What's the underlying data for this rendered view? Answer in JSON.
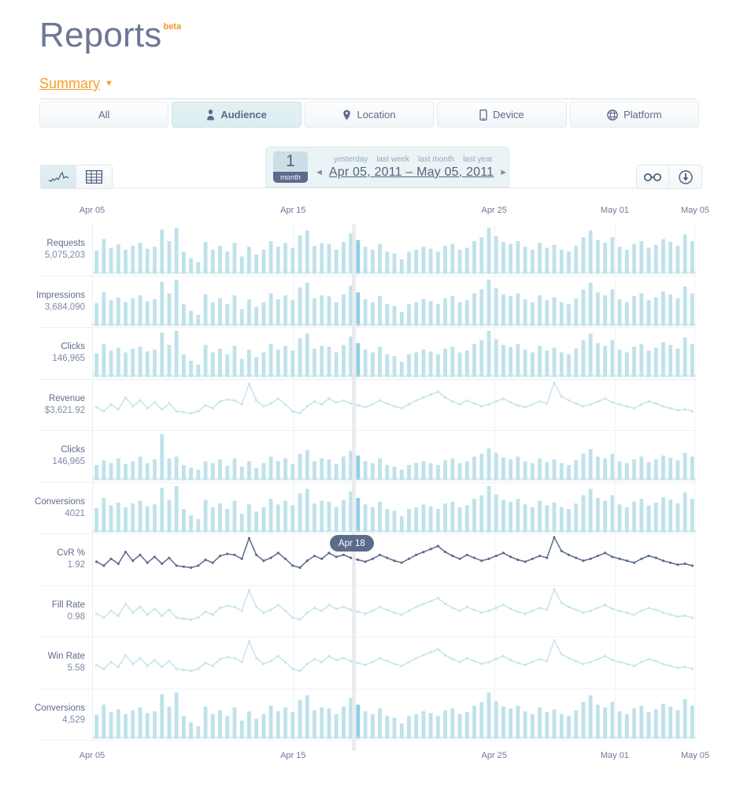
{
  "header": {
    "title": "Reports",
    "beta": "beta",
    "summary_label": "Summary",
    "summary_caret": "▼"
  },
  "tabs": [
    {
      "label": "All",
      "icon": "none",
      "active": false
    },
    {
      "label": "Audience",
      "icon": "person-icon",
      "active": true
    },
    {
      "label": "Location",
      "icon": "map-pin-icon",
      "active": false
    },
    {
      "label": "Device",
      "icon": "mobile-phone-icon",
      "active": false
    },
    {
      "label": "Platform",
      "icon": "globe-icon",
      "active": false
    }
  ],
  "toolbar": {
    "view_chart_icon": "line-chart-icon",
    "view_table_icon": "table-grid-icon",
    "link_icon": "chain-link-icon",
    "download_icon": "download-circle-icon",
    "daterange": {
      "badge_number": "1",
      "badge_unit": "month",
      "quick_links": [
        "yesterday",
        "last week",
        "last month",
        "last year"
      ],
      "prev_arrow": "◄",
      "next_arrow": "►",
      "range_text": "Apr 05, 2011  –  May 05, 2011"
    }
  },
  "tooltip": {
    "label": "Apr 18"
  },
  "colors": {
    "accent_orange": "#f5a02a",
    "text_blue": "#5d6a8a",
    "bar_light": "#bfe2ea",
    "line_light": "#c6e5ec",
    "line_dark": "#5c6b8c",
    "tab_active_bg": "#dceef1"
  },
  "chart_data": {
    "type": "line",
    "title": "Reports — Audience summary",
    "xlabel": "",
    "ylabel": "",
    "grid": true,
    "legend": "none",
    "x_axis_ticks": [
      {
        "label": "Apr 05",
        "pos": 0.0
      },
      {
        "label": "Apr 15",
        "pos": 0.3333
      },
      {
        "label": "Apr 25",
        "pos": 0.6667
      },
      {
        "label": "May 01",
        "pos": 0.8667
      },
      {
        "label": "May 05",
        "pos": 1.0
      }
    ],
    "x_range": [
      "Apr 05, 2011",
      "May 05, 2011"
    ],
    "highlight": {
      "label": "Apr 18",
      "pos": 0.4333
    },
    "series": [
      {
        "name": "Requests",
        "total": "5,075,203",
        "type": "bar",
        "color": "#bfe2ea",
        "values": [
          42,
          66,
          48,
          55,
          44,
          52,
          58,
          46,
          50,
          86,
          62,
          90,
          40,
          26,
          18,
          60,
          44,
          52,
          40,
          58,
          30,
          50,
          34,
          44,
          62,
          50,
          58,
          48,
          74,
          84,
          52,
          58,
          56,
          44,
          60,
          78,
          64,
          50,
          44,
          56,
          40,
          36,
          24,
          40,
          44,
          50,
          46,
          40,
          52,
          56,
          44,
          48,
          62,
          70,
          90,
          72,
          60,
          56,
          62,
          50,
          44,
          58,
          48,
          54,
          44,
          40,
          52,
          70,
          84,
          64,
          58,
          70,
          50,
          44,
          56,
          62,
          48,
          54,
          66,
          60,
          52,
          76,
          62
        ]
      },
      {
        "name": "Impressions",
        "total": "3,684,090",
        "type": "bar",
        "color": "#bfe2ea",
        "values": [
          40,
          62,
          46,
          52,
          42,
          50,
          56,
          44,
          48,
          84,
          60,
          88,
          38,
          24,
          16,
          58,
          42,
          50,
          38,
          56,
          28,
          48,
          32,
          42,
          60,
          48,
          56,
          46,
          72,
          82,
          50,
          56,
          54,
          42,
          58,
          76,
          62,
          48,
          42,
          54,
          38,
          34,
          22,
          38,
          42,
          48,
          44,
          38,
          50,
          54,
          42,
          46,
          60,
          68,
          88,
          70,
          58,
          54,
          60,
          48,
          42,
          56,
          46,
          52,
          42,
          38,
          50,
          68,
          82,
          62,
          56,
          68,
          48,
          42,
          54,
          60,
          46,
          52,
          64,
          58,
          50,
          74,
          60
        ]
      },
      {
        "name": "Clicks",
        "total": "146,965",
        "type": "bar",
        "color": "#bfe2ea",
        "values": [
          44,
          64,
          50,
          56,
          46,
          54,
          58,
          48,
          52,
          88,
          62,
          92,
          42,
          28,
          20,
          62,
          46,
          54,
          42,
          60,
          32,
          52,
          36,
          46,
          64,
          52,
          60,
          50,
          76,
          86,
          54,
          60,
          58,
          46,
          62,
          80,
          66,
          52,
          46,
          58,
          42,
          38,
          26,
          42,
          46,
          52,
          48,
          42,
          54,
          58,
          46,
          50,
          64,
          72,
          92,
          74,
          62,
          58,
          64,
          52,
          46,
          60,
          50,
          56,
          46,
          42,
          54,
          72,
          86,
          66,
          60,
          72,
          52,
          46,
          58,
          64,
          50,
          56,
          68,
          62,
          54,
          78,
          64
        ]
      },
      {
        "name": "Revenue",
        "total": "$3,621.92",
        "type": "line",
        "color": "#c6e5ec",
        "values": [
          38,
          30,
          44,
          34,
          58,
          40,
          52,
          36,
          48,
          34,
          46,
          30,
          28,
          26,
          30,
          42,
          36,
          50,
          54,
          52,
          44,
          86,
          52,
          40,
          46,
          56,
          44,
          30,
          26,
          40,
          50,
          44,
          56,
          48,
          52,
          46,
          42,
          38,
          44,
          52,
          46,
          40,
          36,
          44,
          52,
          58,
          64,
          70,
          58,
          50,
          44,
          52,
          46,
          40,
          44,
          50,
          56,
          48,
          42,
          38,
          44,
          50,
          46,
          88,
          60,
          52,
          46,
          40,
          44,
          50,
          56,
          48,
          44,
          40,
          36,
          44,
          50,
          46,
          40,
          36,
          32,
          34,
          30
        ]
      },
      {
        "name": "Clicks",
        "total": "146,965",
        "type": "bar",
        "color": "#bfe2ea",
        "values": [
          26,
          36,
          30,
          40,
          28,
          34,
          44,
          30,
          38,
          92,
          40,
          44,
          26,
          20,
          16,
          34,
          30,
          38,
          24,
          40,
          22,
          34,
          20,
          30,
          44,
          34,
          40,
          28,
          50,
          58,
          34,
          40,
          38,
          28,
          44,
          56,
          46,
          34,
          30,
          40,
          26,
          22,
          16,
          26,
          30,
          34,
          30,
          26,
          36,
          40,
          30,
          34,
          44,
          50,
          62,
          52,
          42,
          38,
          44,
          34,
          30,
          40,
          32,
          38,
          30,
          26,
          36,
          50,
          60,
          44,
          40,
          50,
          34,
          30,
          38,
          44,
          32,
          38,
          46,
          42,
          36,
          52,
          44
        ]
      },
      {
        "name": "Conversions",
        "total": "4021",
        "type": "bar",
        "color": "#bfe2ea",
        "values": [
          46,
          68,
          52,
          58,
          48,
          56,
          62,
          50,
          54,
          90,
          64,
          94,
          44,
          30,
          22,
          64,
          48,
          56,
          44,
          62,
          34,
          54,
          38,
          48,
          66,
          54,
          62,
          52,
          78,
          88,
          56,
          62,
          60,
          48,
          64,
          82,
          68,
          54,
          48,
          60,
          44,
          40,
          28,
          44,
          48,
          54,
          50,
          44,
          56,
          60,
          48,
          52,
          66,
          74,
          94,
          76,
          64,
          60,
          66,
          54,
          48,
          62,
          52,
          58,
          48,
          44,
          56,
          74,
          88,
          68,
          62,
          74,
          54,
          48,
          60,
          66,
          52,
          58,
          70,
          64,
          56,
          80,
          66
        ]
      },
      {
        "name": "CvR %",
        "total": "1.92",
        "type": "line",
        "color": "#5c6b8c",
        "highlighted": true,
        "values": [
          38,
          30,
          44,
          34,
          58,
          40,
          52,
          36,
          48,
          34,
          46,
          30,
          28,
          26,
          30,
          42,
          36,
          50,
          54,
          52,
          44,
          86,
          52,
          40,
          46,
          56,
          44,
          30,
          26,
          40,
          50,
          44,
          56,
          48,
          52,
          46,
          42,
          38,
          44,
          52,
          46,
          40,
          36,
          44,
          52,
          58,
          64,
          70,
          58,
          50,
          44,
          52,
          46,
          40,
          44,
          50,
          56,
          48,
          42,
          38,
          44,
          50,
          46,
          88,
          60,
          52,
          46,
          40,
          44,
          50,
          56,
          48,
          44,
          40,
          36,
          44,
          50,
          46,
          40,
          36,
          32,
          34,
          30
        ]
      },
      {
        "name": "Fill Rate",
        "total": "0.98",
        "type": "line",
        "color": "#c6e5ec",
        "values": [
          38,
          30,
          44,
          34,
          58,
          40,
          52,
          36,
          48,
          34,
          46,
          30,
          28,
          26,
          30,
          42,
          36,
          50,
          54,
          52,
          44,
          86,
          52,
          40,
          46,
          56,
          44,
          30,
          26,
          40,
          50,
          44,
          56,
          48,
          52,
          46,
          42,
          38,
          44,
          52,
          46,
          40,
          36,
          44,
          52,
          58,
          64,
          70,
          58,
          50,
          44,
          52,
          46,
          40,
          44,
          50,
          56,
          48,
          42,
          38,
          44,
          50,
          46,
          88,
          60,
          52,
          46,
          40,
          44,
          50,
          56,
          48,
          44,
          40,
          36,
          44,
          50,
          46,
          40,
          36,
          32,
          34,
          30
        ]
      },
      {
        "name": "Win Rate",
        "total": "5.58",
        "type": "line",
        "color": "#c6e5ec",
        "values": [
          38,
          30,
          44,
          34,
          58,
          40,
          52,
          36,
          48,
          34,
          46,
          30,
          28,
          26,
          30,
          42,
          36,
          50,
          54,
          52,
          44,
          86,
          52,
          40,
          46,
          56,
          44,
          30,
          26,
          40,
          50,
          44,
          56,
          48,
          52,
          46,
          42,
          38,
          44,
          52,
          46,
          40,
          36,
          44,
          52,
          58,
          64,
          70,
          58,
          50,
          44,
          52,
          46,
          40,
          44,
          50,
          56,
          48,
          42,
          38,
          44,
          50,
          46,
          88,
          60,
          52,
          46,
          40,
          44,
          50,
          56,
          48,
          44,
          40,
          36,
          44,
          50,
          46,
          40,
          36,
          32,
          34,
          30
        ]
      },
      {
        "name": "Conversions",
        "total": "4,529",
        "type": "bar",
        "color": "#bfe2ea",
        "values": [
          44,
          66,
          50,
          56,
          46,
          54,
          60,
          48,
          52,
          88,
          62,
          92,
          42,
          28,
          20,
          62,
          46,
          54,
          42,
          60,
          32,
          52,
          36,
          46,
          64,
          52,
          60,
          50,
          76,
          86,
          54,
          60,
          58,
          46,
          62,
          80,
          66,
          52,
          46,
          58,
          42,
          38,
          26,
          42,
          46,
          52,
          48,
          42,
          54,
          58,
          46,
          50,
          64,
          72,
          92,
          74,
          62,
          58,
          64,
          52,
          46,
          60,
          50,
          56,
          46,
          42,
          54,
          72,
          86,
          66,
          60,
          72,
          52,
          46,
          58,
          64,
          50,
          56,
          68,
          62,
          54,
          78,
          64
        ]
      }
    ]
  }
}
